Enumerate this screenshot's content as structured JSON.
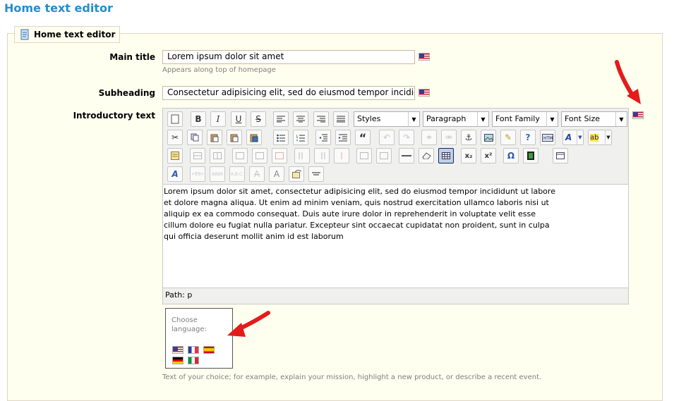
{
  "page": {
    "title": "Home text editor"
  },
  "fieldset": {
    "legend": "Home text editor",
    "icon": "document-icon"
  },
  "fields": {
    "main_title": {
      "label": "Main title",
      "value": "Lorem ipsum dolor sit amet",
      "hint": "Appears along top of homepage"
    },
    "subheading": {
      "label": "Subheading",
      "value": "Consectetur adipisicing elit, sed do eiusmod tempor incididunt u"
    },
    "intro": {
      "label": "Introductory text"
    }
  },
  "toolbar": {
    "selects": {
      "styles": "Styles",
      "paragraph": "Paragraph",
      "font_family": "Font Family",
      "font_size": "Font Size"
    },
    "glyphs": {
      "bold": "B",
      "italic": "I",
      "underline": "U",
      "strike": "S",
      "blockquote": "“",
      "subscript": "x₂",
      "superscript": "x²",
      "omega": "Ω"
    }
  },
  "editor": {
    "content": "Lorem ipsum dolor sit amet, consectetur adipisicing elit, sed do eiusmod tempor incididunt ut labore et dolore magna aliqua. Ut enim ad minim veniam, quis nostrud exercitation ullamco laboris nisi ut aliquip ex ea commodo consequat. Duis aute irure dolor in reprehenderit in voluptate velit esse cillum dolore eu fugiat nulla pariatur. Excepteur sint occaecat cupidatat non proident, sunt in culpa qui officia deserunt mollit anim id est laborum",
    "path": "Path: p"
  },
  "language_chooser": {
    "title": "Choose language:"
  },
  "footer_hint": "Text of your choice; for example, explain your mission, highlight a new product, or describe a recent event.",
  "colors": {
    "title_blue": "#268ccd",
    "panel_bg": "#fffff0",
    "arrow_red": "#e31b1b"
  }
}
